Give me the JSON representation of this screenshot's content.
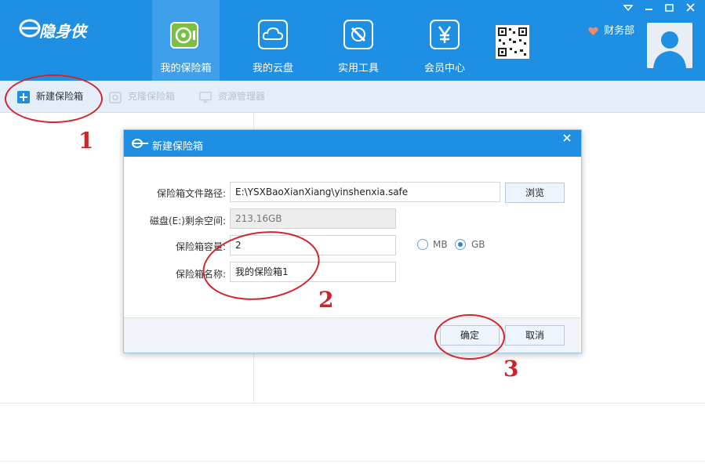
{
  "app": {
    "logo_text": "隐身侠",
    "logo_small": "YSX"
  },
  "nav": {
    "items": [
      {
        "label": "我的保险箱",
        "icon": "safe-icon"
      },
      {
        "label": "我的云盘",
        "icon": "cloud-icon"
      },
      {
        "label": "实用工具",
        "icon": "tools-icon"
      },
      {
        "label": "会员中心",
        "icon": "yen-icon"
      }
    ]
  },
  "header": {
    "finance_label": "财务部"
  },
  "toolbar": {
    "new_safe": "新建保险箱",
    "clone_safe": "克隆保险箱",
    "resource_manager": "资源管理器"
  },
  "dialog": {
    "title": "新建保险箱",
    "path_label": "保险箱文件路径:",
    "path_value": "E:\\YSXBaoXianXiang\\yinshenxia.safe",
    "browse_button": "浏览",
    "space_label": "磁盘(E:)剩余空间:",
    "space_value": "213.16GB",
    "capacity_label": "保险箱容量:",
    "capacity_value": "2",
    "unit_mb": "MB",
    "unit_gb": "GB",
    "selected_unit": "GB",
    "name_label": "保险箱名称:",
    "name_value": "我的保险箱1",
    "ok_button": "确定",
    "cancel_button": "取消"
  },
  "annotations": {
    "step1": "1",
    "step2": "2",
    "step3": "3"
  },
  "colors": {
    "header_blue": "#1f8fe3",
    "annotation_red": "#d0262b"
  }
}
